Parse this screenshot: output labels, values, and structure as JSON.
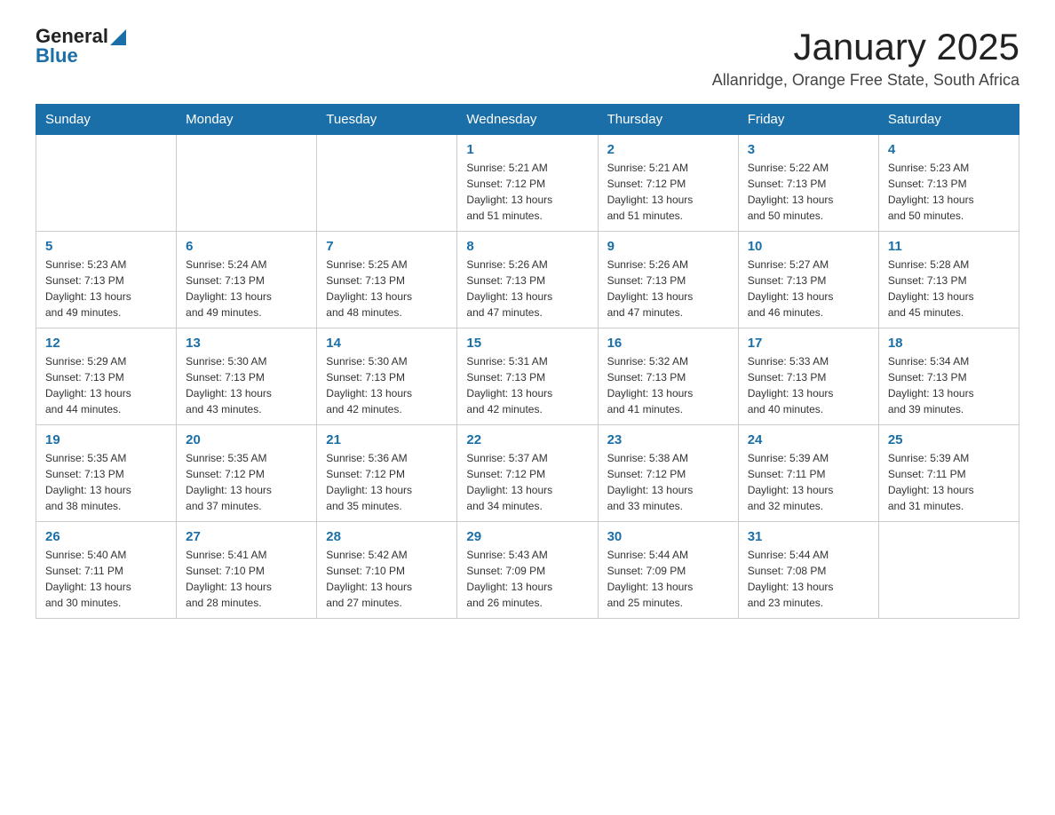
{
  "header": {
    "logo_general": "General",
    "logo_blue": "Blue",
    "title": "January 2025",
    "subtitle": "Allanridge, Orange Free State, South Africa"
  },
  "weekdays": [
    "Sunday",
    "Monday",
    "Tuesday",
    "Wednesday",
    "Thursday",
    "Friday",
    "Saturday"
  ],
  "weeks": [
    [
      {
        "day": "",
        "info": ""
      },
      {
        "day": "",
        "info": ""
      },
      {
        "day": "",
        "info": ""
      },
      {
        "day": "1",
        "info": "Sunrise: 5:21 AM\nSunset: 7:12 PM\nDaylight: 13 hours\nand 51 minutes."
      },
      {
        "day": "2",
        "info": "Sunrise: 5:21 AM\nSunset: 7:12 PM\nDaylight: 13 hours\nand 51 minutes."
      },
      {
        "day": "3",
        "info": "Sunrise: 5:22 AM\nSunset: 7:13 PM\nDaylight: 13 hours\nand 50 minutes."
      },
      {
        "day": "4",
        "info": "Sunrise: 5:23 AM\nSunset: 7:13 PM\nDaylight: 13 hours\nand 50 minutes."
      }
    ],
    [
      {
        "day": "5",
        "info": "Sunrise: 5:23 AM\nSunset: 7:13 PM\nDaylight: 13 hours\nand 49 minutes."
      },
      {
        "day": "6",
        "info": "Sunrise: 5:24 AM\nSunset: 7:13 PM\nDaylight: 13 hours\nand 49 minutes."
      },
      {
        "day": "7",
        "info": "Sunrise: 5:25 AM\nSunset: 7:13 PM\nDaylight: 13 hours\nand 48 minutes."
      },
      {
        "day": "8",
        "info": "Sunrise: 5:26 AM\nSunset: 7:13 PM\nDaylight: 13 hours\nand 47 minutes."
      },
      {
        "day": "9",
        "info": "Sunrise: 5:26 AM\nSunset: 7:13 PM\nDaylight: 13 hours\nand 47 minutes."
      },
      {
        "day": "10",
        "info": "Sunrise: 5:27 AM\nSunset: 7:13 PM\nDaylight: 13 hours\nand 46 minutes."
      },
      {
        "day": "11",
        "info": "Sunrise: 5:28 AM\nSunset: 7:13 PM\nDaylight: 13 hours\nand 45 minutes."
      }
    ],
    [
      {
        "day": "12",
        "info": "Sunrise: 5:29 AM\nSunset: 7:13 PM\nDaylight: 13 hours\nand 44 minutes."
      },
      {
        "day": "13",
        "info": "Sunrise: 5:30 AM\nSunset: 7:13 PM\nDaylight: 13 hours\nand 43 minutes."
      },
      {
        "day": "14",
        "info": "Sunrise: 5:30 AM\nSunset: 7:13 PM\nDaylight: 13 hours\nand 42 minutes."
      },
      {
        "day": "15",
        "info": "Sunrise: 5:31 AM\nSunset: 7:13 PM\nDaylight: 13 hours\nand 42 minutes."
      },
      {
        "day": "16",
        "info": "Sunrise: 5:32 AM\nSunset: 7:13 PM\nDaylight: 13 hours\nand 41 minutes."
      },
      {
        "day": "17",
        "info": "Sunrise: 5:33 AM\nSunset: 7:13 PM\nDaylight: 13 hours\nand 40 minutes."
      },
      {
        "day": "18",
        "info": "Sunrise: 5:34 AM\nSunset: 7:13 PM\nDaylight: 13 hours\nand 39 minutes."
      }
    ],
    [
      {
        "day": "19",
        "info": "Sunrise: 5:35 AM\nSunset: 7:13 PM\nDaylight: 13 hours\nand 38 minutes."
      },
      {
        "day": "20",
        "info": "Sunrise: 5:35 AM\nSunset: 7:12 PM\nDaylight: 13 hours\nand 37 minutes."
      },
      {
        "day": "21",
        "info": "Sunrise: 5:36 AM\nSunset: 7:12 PM\nDaylight: 13 hours\nand 35 minutes."
      },
      {
        "day": "22",
        "info": "Sunrise: 5:37 AM\nSunset: 7:12 PM\nDaylight: 13 hours\nand 34 minutes."
      },
      {
        "day": "23",
        "info": "Sunrise: 5:38 AM\nSunset: 7:12 PM\nDaylight: 13 hours\nand 33 minutes."
      },
      {
        "day": "24",
        "info": "Sunrise: 5:39 AM\nSunset: 7:11 PM\nDaylight: 13 hours\nand 32 minutes."
      },
      {
        "day": "25",
        "info": "Sunrise: 5:39 AM\nSunset: 7:11 PM\nDaylight: 13 hours\nand 31 minutes."
      }
    ],
    [
      {
        "day": "26",
        "info": "Sunrise: 5:40 AM\nSunset: 7:11 PM\nDaylight: 13 hours\nand 30 minutes."
      },
      {
        "day": "27",
        "info": "Sunrise: 5:41 AM\nSunset: 7:10 PM\nDaylight: 13 hours\nand 28 minutes."
      },
      {
        "day": "28",
        "info": "Sunrise: 5:42 AM\nSunset: 7:10 PM\nDaylight: 13 hours\nand 27 minutes."
      },
      {
        "day": "29",
        "info": "Sunrise: 5:43 AM\nSunset: 7:09 PM\nDaylight: 13 hours\nand 26 minutes."
      },
      {
        "day": "30",
        "info": "Sunrise: 5:44 AM\nSunset: 7:09 PM\nDaylight: 13 hours\nand 25 minutes."
      },
      {
        "day": "31",
        "info": "Sunrise: 5:44 AM\nSunset: 7:08 PM\nDaylight: 13 hours\nand 23 minutes."
      },
      {
        "day": "",
        "info": ""
      }
    ]
  ]
}
